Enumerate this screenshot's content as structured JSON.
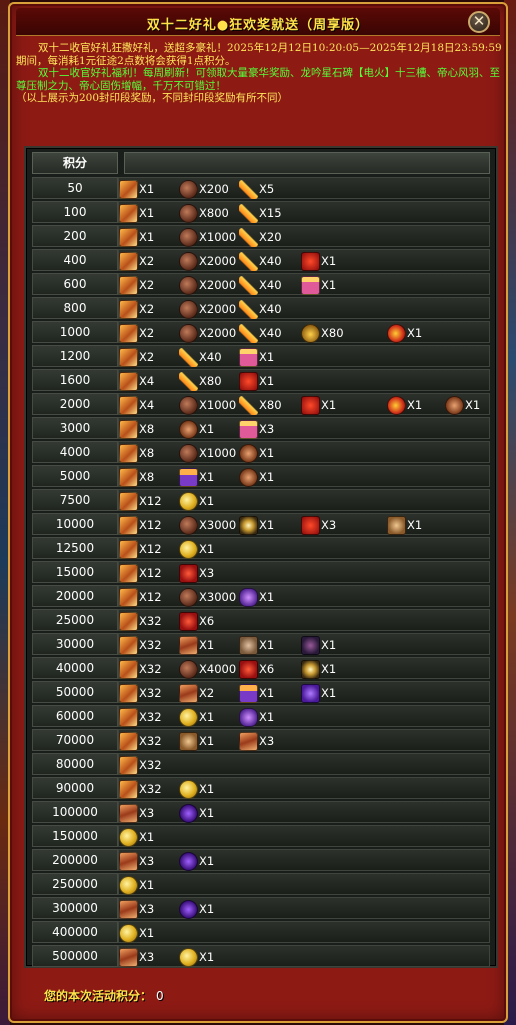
{
  "window": {
    "title": "双十二好礼●狂欢奖就送（周享版）",
    "close_label": "✕"
  },
  "description": {
    "line1": "双十二收官好礼狂撒好礼，送超多豪礼！2025年12月12日10:20:05—2025年12月18日23:59:59期间，每消耗1元征途2点数将会获得1点积分。",
    "line2": "双十二收官好礼福利！每周刷新！可领取大量豪华奖励、龙吟星石碑【电火】十三槽、帝心风羽、至尊压制之力、帝心固伤增幅，千万不可错过！",
    "line3": "（以上展示为200封印段奖励，不同封印段奖励有所不同）"
  },
  "table": {
    "header_score": "积分",
    "rows": [
      {
        "score": "50",
        "items": [
          {
            "icon": "stamp-icon",
            "qty": "X1"
          },
          {
            "icon": "ore-icon",
            "qty": "X200"
          },
          {
            "icon": "feather-icon",
            "qty": "X5"
          }
        ]
      },
      {
        "score": "100",
        "items": [
          {
            "icon": "stamp-icon",
            "qty": "X1"
          },
          {
            "icon": "ore-icon",
            "qty": "X800"
          },
          {
            "icon": "feather-icon",
            "qty": "X15"
          }
        ]
      },
      {
        "score": "200",
        "items": [
          {
            "icon": "stamp-icon",
            "qty": "X1"
          },
          {
            "icon": "ore-icon",
            "qty": "X1000"
          },
          {
            "icon": "feather-icon",
            "qty": "X20"
          }
        ]
      },
      {
        "score": "400",
        "items": [
          {
            "icon": "stamp-icon",
            "qty": "X2"
          },
          {
            "icon": "ore-icon",
            "qty": "X2000"
          },
          {
            "icon": "feather-icon",
            "qty": "X40"
          },
          {
            "icon": "giftbox-icon",
            "qty": "X1"
          }
        ]
      },
      {
        "score": "600",
        "items": [
          {
            "icon": "stamp-icon",
            "qty": "X2"
          },
          {
            "icon": "ore-icon",
            "qty": "X2000"
          },
          {
            "icon": "feather-icon",
            "qty": "X40"
          },
          {
            "icon": "giftpack-icon",
            "qty": "X1"
          }
        ]
      },
      {
        "score": "800",
        "items": [
          {
            "icon": "stamp-icon",
            "qty": "X2"
          },
          {
            "icon": "ore-icon",
            "qty": "X2000"
          },
          {
            "icon": "feather-icon",
            "qty": "X40"
          }
        ]
      },
      {
        "score": "1000",
        "items": [
          {
            "icon": "stamp-icon",
            "qty": "X2"
          },
          {
            "icon": "ore-icon",
            "qty": "X2000"
          },
          {
            "icon": "feather-icon",
            "qty": "X40"
          },
          {
            "icon": "goldpile-icon",
            "qty": "X80"
          },
          {
            "icon": "firegem-icon",
            "qty": "X1"
          }
        ]
      },
      {
        "score": "1200",
        "items": [
          {
            "icon": "stamp-icon",
            "qty": "X2"
          },
          {
            "icon": "feather-icon",
            "qty": "X40"
          },
          {
            "icon": "giftpack-icon",
            "qty": "X1"
          }
        ]
      },
      {
        "score": "1600",
        "items": [
          {
            "icon": "stamp-icon",
            "qty": "X4"
          },
          {
            "icon": "feather-icon",
            "qty": "X80"
          },
          {
            "icon": "giftbox-icon",
            "qty": "X1"
          }
        ]
      },
      {
        "score": "2000",
        "items": [
          {
            "icon": "stamp-icon",
            "qty": "X4"
          },
          {
            "icon": "ore-icon",
            "qty": "X1000"
          },
          {
            "icon": "feather-icon",
            "qty": "X80"
          },
          {
            "icon": "giftbox-icon",
            "qty": "X1"
          },
          {
            "icon": "firegem-icon",
            "qty": "X1"
          },
          {
            "icon": "cookie-icon",
            "qty": "X1"
          }
        ]
      },
      {
        "score": "3000",
        "items": [
          {
            "icon": "stamp-icon",
            "qty": "X8"
          },
          {
            "icon": "cookie-icon",
            "qty": "X1"
          },
          {
            "icon": "giftpack-icon",
            "qty": "X3"
          }
        ]
      },
      {
        "score": "4000",
        "items": [
          {
            "icon": "stamp-icon",
            "qty": "X8"
          },
          {
            "icon": "ore-icon",
            "qty": "X1000"
          },
          {
            "icon": "cookie-icon",
            "qty": "X1"
          }
        ]
      },
      {
        "score": "5000",
        "items": [
          {
            "icon": "stamp-icon",
            "qty": "X8"
          },
          {
            "icon": "purplebox-icon",
            "qty": "X1"
          },
          {
            "icon": "cookie-icon",
            "qty": "X1"
          }
        ]
      },
      {
        "score": "7500",
        "items": [
          {
            "icon": "stamp-icon",
            "qty": "X12"
          },
          {
            "icon": "coin-icon",
            "qty": "X1"
          }
        ]
      },
      {
        "score": "10000",
        "items": [
          {
            "icon": "stamp-icon",
            "qty": "X12"
          },
          {
            "icon": "ore-icon",
            "qty": "X3000"
          },
          {
            "icon": "sparkle-icon",
            "qty": "X1"
          },
          {
            "icon": "giftbox-icon",
            "qty": "X3"
          },
          {
            "icon": "mask-icon",
            "qty": "X1"
          }
        ]
      },
      {
        "score": "12500",
        "items": [
          {
            "icon": "stamp-icon",
            "qty": "X12"
          },
          {
            "icon": "coin-icon",
            "qty": "X1"
          }
        ]
      },
      {
        "score": "15000",
        "items": [
          {
            "icon": "stamp-icon",
            "qty": "X12"
          },
          {
            "icon": "redgem-icon",
            "qty": "X3"
          }
        ]
      },
      {
        "score": "20000",
        "items": [
          {
            "icon": "stamp-icon",
            "qty": "X12"
          },
          {
            "icon": "ore-icon",
            "qty": "X3000"
          },
          {
            "icon": "purplewings-icon",
            "qty": "X1"
          }
        ]
      },
      {
        "score": "25000",
        "items": [
          {
            "icon": "stamp-icon",
            "qty": "X32"
          },
          {
            "icon": "redgem-icon",
            "qty": "X6"
          }
        ]
      },
      {
        "score": "30000",
        "items": [
          {
            "icon": "stamp-icon",
            "qty": "X32"
          },
          {
            "icon": "scroll-icon",
            "qty": "X1"
          },
          {
            "icon": "beast-icon",
            "qty": "X1"
          },
          {
            "icon": "darkportrait-icon",
            "qty": "X1"
          }
        ]
      },
      {
        "score": "40000",
        "items": [
          {
            "icon": "stamp-icon",
            "qty": "X32"
          },
          {
            "icon": "ore-icon",
            "qty": "X4000"
          },
          {
            "icon": "redgem-icon",
            "qty": "X6"
          },
          {
            "icon": "sparkle-icon",
            "qty": "X1"
          }
        ]
      },
      {
        "score": "50000",
        "items": [
          {
            "icon": "stamp-icon",
            "qty": "X32"
          },
          {
            "icon": "scroll-icon",
            "qty": "X2"
          },
          {
            "icon": "purplebox-icon",
            "qty": "X1"
          },
          {
            "icon": "violetrune-icon",
            "qty": "X1"
          }
        ]
      },
      {
        "score": "60000",
        "items": [
          {
            "icon": "stamp-icon",
            "qty": "X32"
          },
          {
            "icon": "coin-icon",
            "qty": "X1"
          },
          {
            "icon": "purplewings-icon",
            "qty": "X1"
          }
        ]
      },
      {
        "score": "70000",
        "items": [
          {
            "icon": "stamp-icon",
            "qty": "X32"
          },
          {
            "icon": "mask-icon",
            "qty": "X1"
          },
          {
            "icon": "scroll-icon",
            "qty": "X3"
          }
        ]
      },
      {
        "score": "80000",
        "items": [
          {
            "icon": "stamp-icon",
            "qty": "X32"
          }
        ]
      },
      {
        "score": "90000",
        "items": [
          {
            "icon": "stamp-icon",
            "qty": "X32"
          },
          {
            "icon": "coin-icon",
            "qty": "X1"
          }
        ]
      },
      {
        "score": "100000",
        "items": [
          {
            "icon": "scroll-icon",
            "qty": "X3"
          },
          {
            "icon": "violetorb-icon",
            "qty": "X1"
          }
        ]
      },
      {
        "score": "150000",
        "items": [
          {
            "icon": "coin-icon",
            "qty": "X1"
          }
        ]
      },
      {
        "score": "200000",
        "items": [
          {
            "icon": "scroll-icon",
            "qty": "X3"
          },
          {
            "icon": "violetorb-icon",
            "qty": "X1"
          }
        ]
      },
      {
        "score": "250000",
        "items": [
          {
            "icon": "coin-icon",
            "qty": "X1"
          }
        ]
      },
      {
        "score": "300000",
        "items": [
          {
            "icon": "scroll-icon",
            "qty": "X3"
          },
          {
            "icon": "violetorb-icon",
            "qty": "X1"
          }
        ]
      },
      {
        "score": "400000",
        "items": [
          {
            "icon": "coin-icon",
            "qty": "X1"
          }
        ]
      },
      {
        "score": "500000",
        "items": [
          {
            "icon": "scroll-icon",
            "qty": "X3"
          },
          {
            "icon": "coin-icon",
            "qty": "X1"
          }
        ]
      }
    ]
  },
  "footer": {
    "label": "您的本次活动积分：",
    "value": "0"
  }
}
